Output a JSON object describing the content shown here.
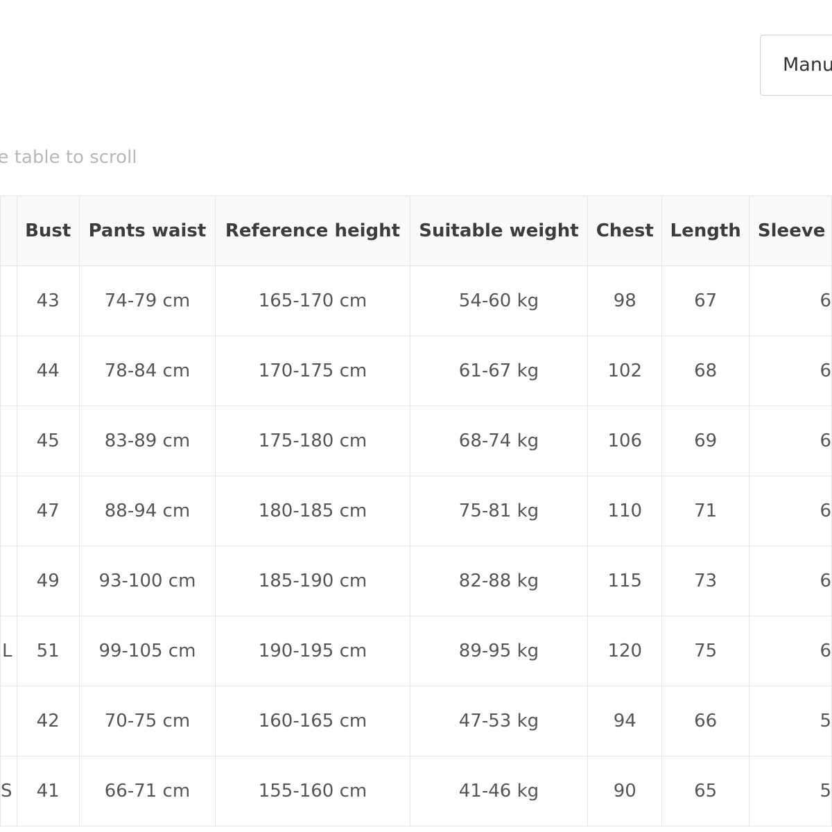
{
  "toolbar": {
    "manual_label": "Manu"
  },
  "hint": {
    "text": "he table to scroll"
  },
  "table": {
    "headers": [
      "",
      "Bust",
      "Pants waist",
      "Reference height",
      "Suitable weight",
      "Chest",
      "Length",
      "Sleeve"
    ],
    "rows": [
      [
        "",
        "43",
        "74-79 cm",
        "165-170 cm",
        "54-60 kg",
        "98",
        "67",
        "6"
      ],
      [
        "",
        "44",
        "78-84 cm",
        "170-175 cm",
        "61-67 kg",
        "102",
        "68",
        "6"
      ],
      [
        "",
        "45",
        "83-89 cm",
        "175-180 cm",
        "68-74 kg",
        "106",
        "69",
        "6"
      ],
      [
        "",
        "47",
        "88-94 cm",
        "180-185 cm",
        "75-81 kg",
        "110",
        "71",
        "6"
      ],
      [
        "",
        "49",
        "93-100 cm",
        "185-190 cm",
        "82-88 kg",
        "115",
        "73",
        "6"
      ],
      [
        "L",
        "51",
        "99-105 cm",
        "190-195 cm",
        "89-95 kg",
        "120",
        "75",
        "6"
      ],
      [
        "",
        "42",
        "70-75 cm",
        "160-165 cm",
        "47-53 kg",
        "94",
        "66",
        "5"
      ],
      [
        "S",
        "41",
        "66-71 cm",
        "155-160 cm",
        "41-46 kg",
        "90",
        "65",
        "5"
      ]
    ]
  }
}
